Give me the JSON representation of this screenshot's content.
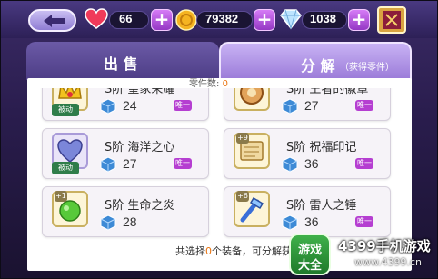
{
  "colors": {
    "accent_orange": "#e9730f",
    "unique_purple": "#b53ed1",
    "passive_green": "#2f7d4a"
  },
  "topbar": {
    "back_icon": "back-arrow-icon",
    "hearts": {
      "icon": "heart-icon",
      "value": "66"
    },
    "gold": {
      "icon": "gold-coin-icon",
      "value": "79382"
    },
    "diamonds": {
      "icon": "diamond-icon",
      "value": "1038"
    },
    "plus_label": "+",
    "book_icon": "book-icon"
  },
  "tabs": [
    {
      "label": "出 售",
      "active": false
    },
    {
      "label": "分 解",
      "sub": "（获得零件）",
      "active": true
    }
  ],
  "parts_count": {
    "label": "零件数:",
    "value": "0"
  },
  "items": [
    {
      "name": "S阶 皇家荣耀",
      "value": "24",
      "passive": "被动",
      "unique": "唯一",
      "icon": "crown-item-icon"
    },
    {
      "name": "S阶 王者的徽章",
      "value": "27",
      "unique": "唯一",
      "icon": "badge-item-icon"
    },
    {
      "name": "S阶 海洋之心",
      "value": "27",
      "passive": "被动",
      "unique": "唯一",
      "icon": "heart-gem-item-icon"
    },
    {
      "name": "S阶 祝福印记",
      "value": "36",
      "plus": "+9",
      "unique": "唯一",
      "icon": "scroll-item-icon"
    },
    {
      "name": "S阶 生命之炎",
      "value": "28",
      "plus": "+1",
      "icon": "green-flame-item-icon"
    },
    {
      "name": "S阶 雷人之锤",
      "value": "36",
      "plus": "+6",
      "unique": "唯一",
      "icon": "hammer-item-icon"
    }
  ],
  "bottom": {
    "prefix": "共选择",
    "count": "0",
    "suffix": "个装备，可分解获",
    "tail": "件"
  },
  "watermark": {
    "logo_top": "游戏",
    "logo_bottom": "大全",
    "brand": "4399手机游戏",
    "url": "www.4399.cn"
  }
}
